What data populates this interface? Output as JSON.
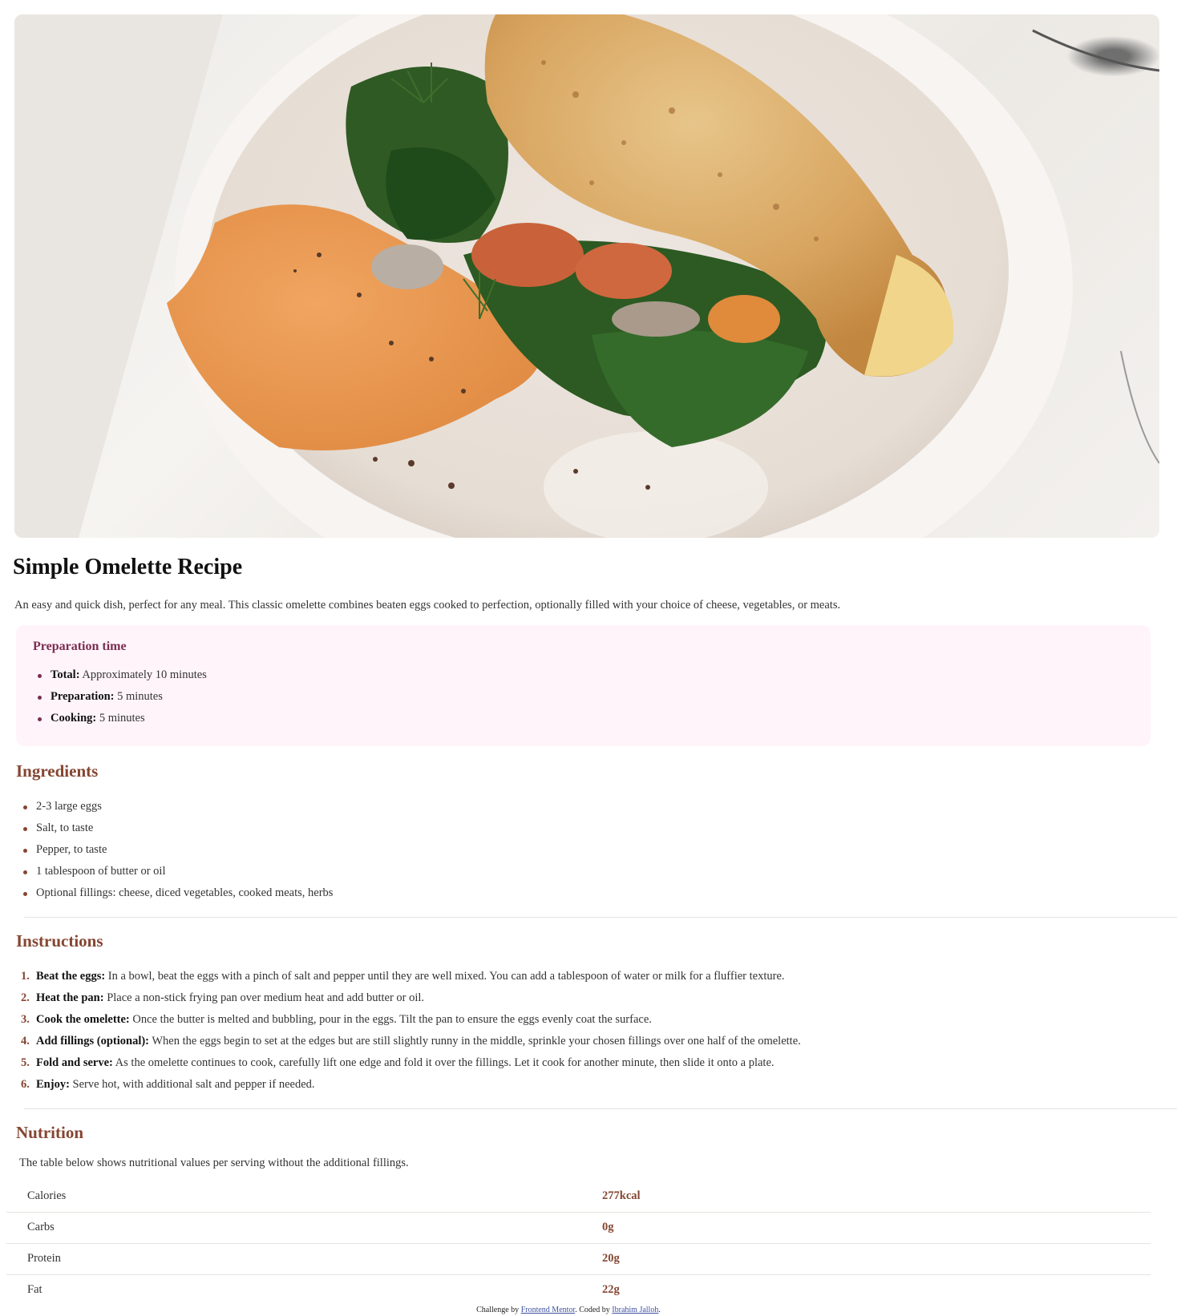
{
  "recipe": {
    "title": "Simple Omelette Recipe",
    "intro": "An easy and quick dish, perfect for any meal. This classic omelette combines beaten eggs cooked to perfection, optionally filled with your choice of cheese, vegetables, or meats.",
    "hero_image": "omelette-plate-image"
  },
  "prep": {
    "heading": "Preparation time",
    "items": [
      {
        "label": "Total:",
        "value": " Approximately 10 minutes"
      },
      {
        "label": "Preparation:",
        "value": " 5 minutes"
      },
      {
        "label": "Cooking:",
        "value": " 5 minutes"
      }
    ]
  },
  "ingredients": {
    "heading": "Ingredients",
    "items": [
      "2-3 large eggs",
      "Salt, to taste",
      "Pepper, to taste",
      "1 tablespoon of butter or oil",
      "Optional fillings: cheese, diced vegetables, cooked meats, herbs"
    ]
  },
  "instructions": {
    "heading": "Instructions",
    "items": [
      {
        "num": "1.",
        "label": "Beat the eggs:",
        "text": " In a bowl, beat the eggs with a pinch of salt and pepper until they are well mixed. You can add a tablespoon of water or milk for a fluffier texture."
      },
      {
        "num": "2.",
        "label": "Heat the pan:",
        "text": " Place a non-stick frying pan over medium heat and add butter or oil."
      },
      {
        "num": "3.",
        "label": "Cook the omelette:",
        "text": " Once the butter is melted and bubbling, pour in the eggs. Tilt the pan to ensure the eggs evenly coat the surface."
      },
      {
        "num": "4.",
        "label": "Add fillings (optional):",
        "text": " When the eggs begin to set at the edges but are still slightly runny in the middle, sprinkle your chosen fillings over one half of the omelette."
      },
      {
        "num": "5.",
        "label": "Fold and serve:",
        "text": " As the omelette continues to cook, carefully lift one edge and fold it over the fillings. Let it cook for another minute, then slide it onto a plate."
      },
      {
        "num": "6.",
        "label": "Enjoy:",
        "text": " Serve hot, with additional salt and pepper if needed."
      }
    ]
  },
  "nutrition": {
    "heading": "Nutrition",
    "intro": "The table below shows nutritional values per serving without the additional fillings.",
    "rows": [
      {
        "label": "Calories",
        "value": "277kcal"
      },
      {
        "label": "Carbs",
        "value": "0g"
      },
      {
        "label": "Protein",
        "value": "20g"
      },
      {
        "label": "Fat",
        "value": "22g"
      }
    ]
  },
  "footer": {
    "prefix": "Challenge by ",
    "challenge_link": "Frontend Mentor",
    "middle": ". Coded by ",
    "author_link": "Ibrahim Jalloh",
    "suffix": "."
  },
  "colors": {
    "accent_brown": "#854632",
    "prep_accent": "#7b2d51",
    "prep_bg": "#fff4fa"
  }
}
